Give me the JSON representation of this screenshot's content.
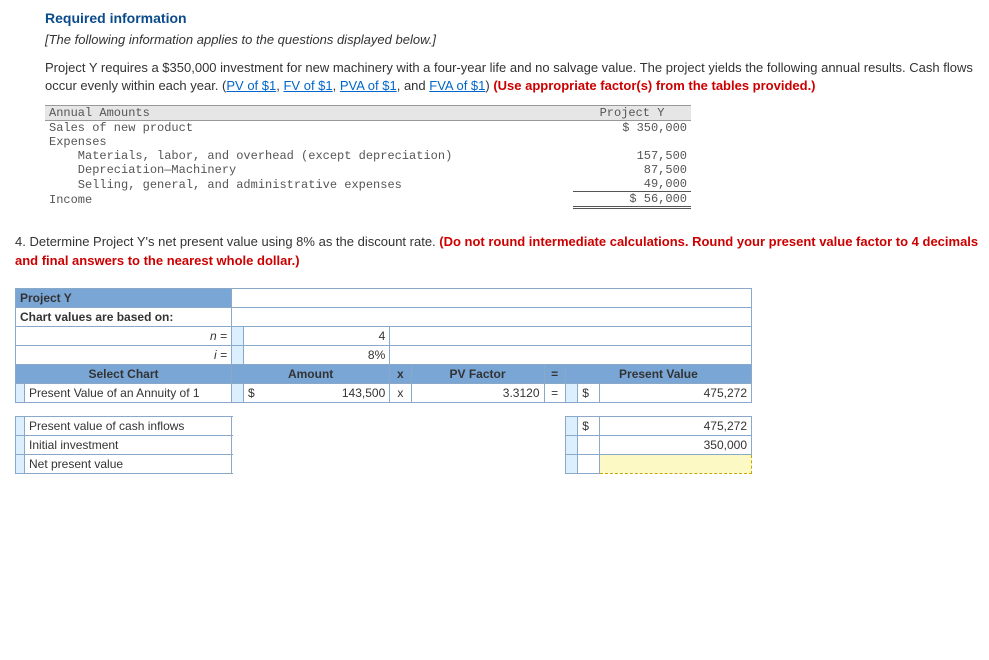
{
  "header": {
    "required_info": "Required information",
    "italic_note": "[The following information applies to the questions displayed below.]",
    "para_pre": "Project Y requires a $350,000 investment for new machinery with a four-year life and no salvage value. The project yields the following annual results. Cash flows occur evenly within each year. (",
    "link_pv1": "PV of $1",
    "sep": ", ",
    "link_fv1": "FV of $1",
    "link_pva1": "PVA of $1",
    "and_text": ", and ",
    "link_fva1": "FVA of $1",
    "paren_close": ") ",
    "red_use": "(Use appropriate factor(s) from the tables provided.)"
  },
  "annual": {
    "title_left": "Annual Amounts",
    "title_right": "Project Y",
    "rows": {
      "sales": {
        "label": "Sales of new product",
        "amt": "$ 350,000"
      },
      "expenses": {
        "label": "Expenses"
      },
      "mat": {
        "label": "    Materials, labor, and overhead (except depreciation)",
        "amt": "157,500"
      },
      "dep": {
        "label": "    Depreciation—Machinery",
        "amt": "87,500"
      },
      "sga": {
        "label": "    Selling, general, and administrative expenses",
        "amt": "49,000"
      },
      "income": {
        "label": "Income",
        "amt": "$ 56,000"
      }
    }
  },
  "q4": {
    "num": "4. ",
    "text": "Determine Project Y's net present value using 8% as the discount rate. ",
    "red": "(Do not round intermediate calculations. Round your present value factor to 4 decimals and final answers to the nearest whole dollar.)"
  },
  "calc": {
    "title": "Project Y",
    "subtitle": "Chart values are based on:",
    "n_label": "n =",
    "n_val": "4",
    "i_label": "i =",
    "i_val": "8%",
    "col_select": "Select Chart",
    "col_amount": "Amount",
    "col_x": "x",
    "col_pv": "PV Factor",
    "col_eq": "=",
    "col_present": "Present Value",
    "row1_chart": "Present Value of an Annuity of 1",
    "row1_amt_sym": "$",
    "row1_amt": "143,500",
    "row1_x": "x",
    "row1_pvf": "3.3120",
    "row1_eq": "=",
    "row1_pv_sym": "$",
    "row1_pv": "475,272",
    "summary1_label": "Present value of cash inflows",
    "summary1_sym": "$",
    "summary1_val": "475,272",
    "summary2_label": "Initial investment",
    "summary2_val": "350,000",
    "summary3_label": "Net present value"
  }
}
